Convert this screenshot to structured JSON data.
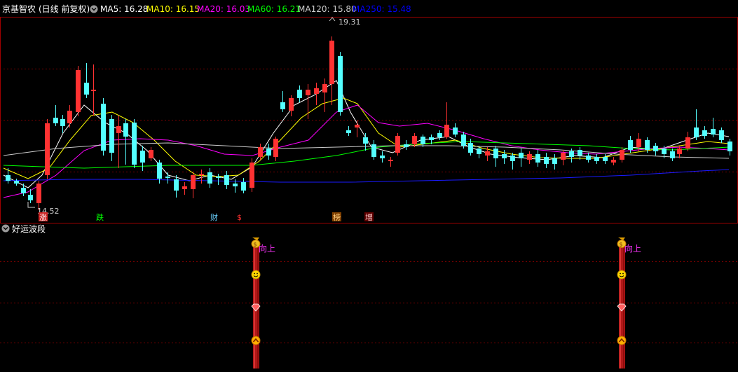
{
  "stock": {
    "name": "京基智农",
    "mode": "(日线 前复权)"
  },
  "ma_legend": [
    {
      "label": "MA5: 16.28",
      "color": "#ffffff"
    },
    {
      "label": "MA10: 16.15",
      "color": "#ffff00"
    },
    {
      "label": "MA20: 16.03",
      "color": "#ff00ff"
    },
    {
      "label": "MA60: 16.21",
      "color": "#00ff00"
    },
    {
      "label": "MA120: 15.80",
      "color": "#cccccc"
    },
    {
      "label": "MA250: 15.48",
      "color": "#0000ff"
    }
  ],
  "price_annotations": {
    "high": "19.31",
    "low": "14.52"
  },
  "event_tags": [
    {
      "text": "涨",
      "color": "#ffffff",
      "bg": "#cc2020"
    },
    {
      "text": "跌",
      "color": "#00ff00",
      "bg": "#000000"
    },
    {
      "text": "财",
      "color": "#6ad0ff",
      "bg": "#000000"
    },
    {
      "text": "$",
      "color": "#ff3030",
      "bg": "#000000"
    },
    {
      "text": "榜",
      "color": "#ffd080",
      "bg": "#804000"
    },
    {
      "text": "增",
      "color": "#ffd0d0",
      "bg": "#600000"
    }
  ],
  "indicator": {
    "title": "好运波段",
    "signals": [
      {
        "label": "向上"
      },
      {
        "label": "向上"
      }
    ]
  },
  "colors": {
    "up": "#ff3232",
    "down": "#54ffff",
    "grid": "#7a0000",
    "frame": "#a00000"
  }
}
